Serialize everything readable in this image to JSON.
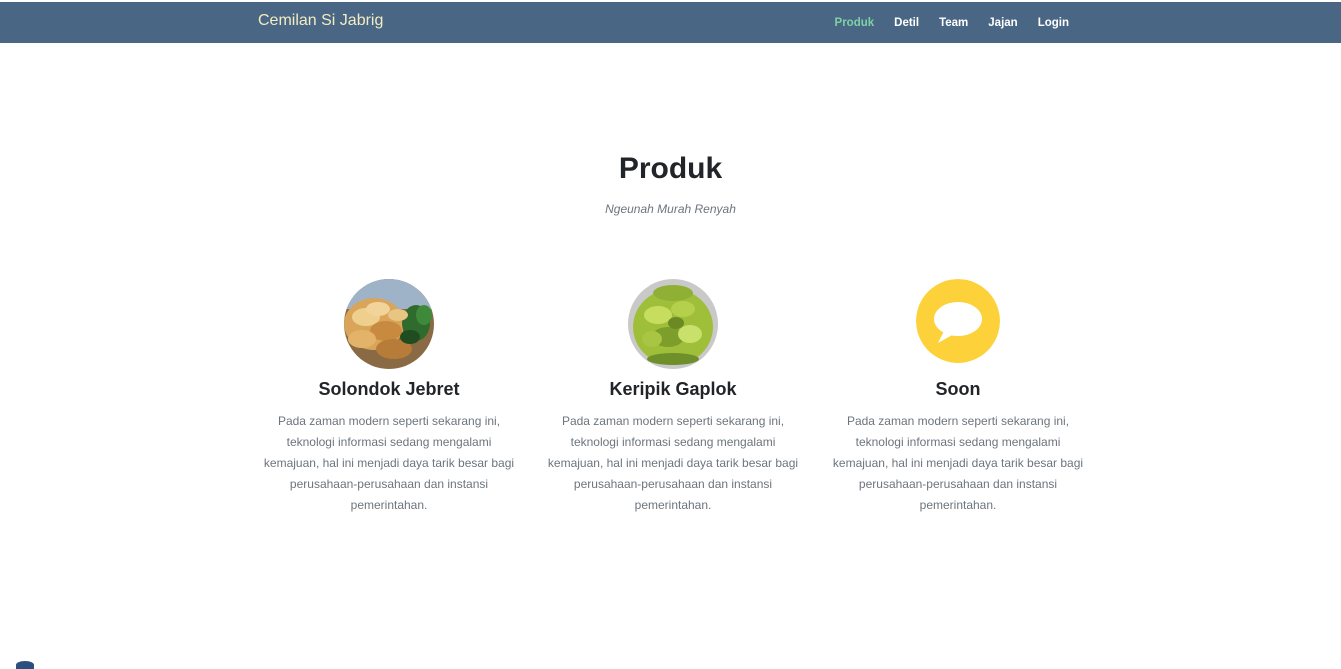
{
  "navbar": {
    "brand": "Cemilan Si Jabrig",
    "items": [
      {
        "label": "Produk",
        "active": true
      },
      {
        "label": "Detil",
        "active": false
      },
      {
        "label": "Team",
        "active": false
      },
      {
        "label": "Jajan",
        "active": false
      },
      {
        "label": "Login",
        "active": false
      }
    ],
    "background_color": "#496785",
    "active_color": "#7fd1a5"
  },
  "section": {
    "title": "Produk",
    "subtitle": "Ngeunah Murah Renyah"
  },
  "products": [
    {
      "name": "Solondok Jebret",
      "image": "fried-crackers-photo",
      "description": "Pada zaman modern seperti sekarang ini, teknologi informasi sedang mengalami kemajuan, hal ini menjadi daya tarik besar bagi perusahaan-perusahaan dan instansi pemerintahan."
    },
    {
      "name": "Keripik Gaplok",
      "image": "green-chips-photo",
      "description": "Pada zaman modern seperti sekarang ini, teknologi informasi sedang mengalami kemajuan, hal ini menjadi daya tarik besar bagi perusahaan-perusahaan dan instansi pemerintahan."
    },
    {
      "name": "Soon",
      "image": "chat-bubble-icon",
      "description": "Pada zaman modern seperti sekarang ini, teknologi informasi sedang mengalami kemajuan, hal ini menjadi daya tarik besar bagi perusahaan-perusahaan dan instansi pemerintahan."
    }
  ]
}
